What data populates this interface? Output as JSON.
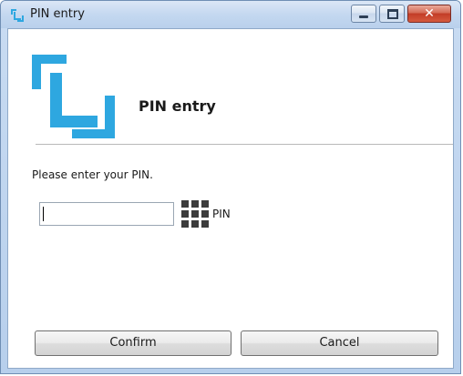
{
  "window": {
    "title": "PIN entry",
    "icon": "pin-entry-app-icon"
  },
  "controls": {
    "minimize_icon": "minimize-icon",
    "maximize_icon": "maximize-icon",
    "close_icon": "close-icon",
    "close_glyph": "✕"
  },
  "header": {
    "title": "PIN entry",
    "logo": "pin-entry-logo"
  },
  "form": {
    "prompt": "Please enter your PIN.",
    "pin_value": "",
    "pin_label": "PIN",
    "keypad_icon": "keypad-icon"
  },
  "buttons": {
    "confirm": "Confirm",
    "cancel": "Cancel"
  },
  "colors": {
    "brand": "#2ea7e0",
    "close_button": "#c94a33"
  }
}
